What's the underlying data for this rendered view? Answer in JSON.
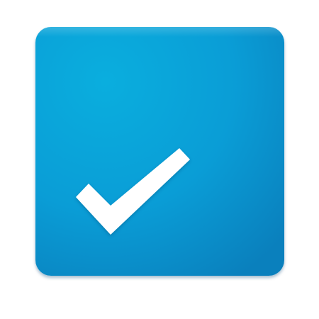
{
  "icon": {
    "name": "checkmark-app-icon",
    "glyph": "checkmark-icon",
    "colors": {
      "tile_light": "#0aaede",
      "tile_base": "#0a9dd6",
      "tile_dark": "#0a80bd",
      "check": "#ffffff"
    }
  }
}
